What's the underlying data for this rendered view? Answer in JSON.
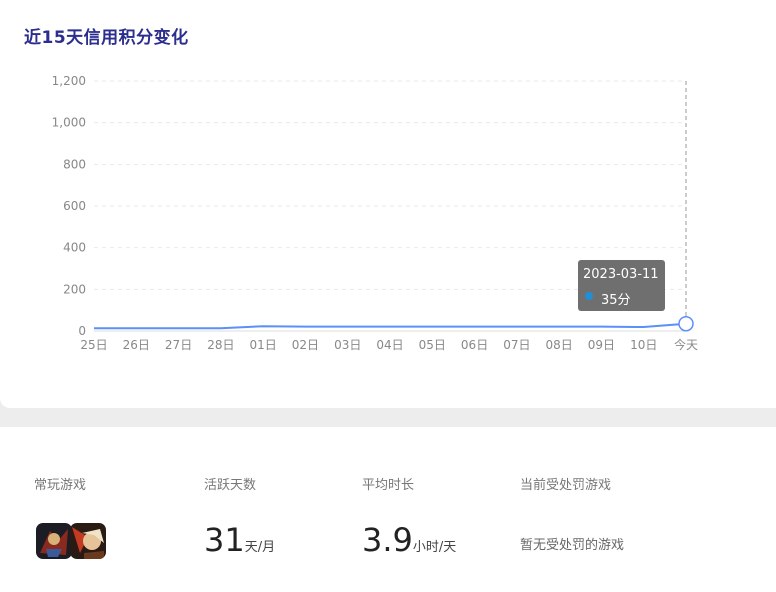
{
  "title": "近15天信用积分变化",
  "chart_data": {
    "type": "line",
    "categories": [
      "25日",
      "26日",
      "27日",
      "28日",
      "01日",
      "02日",
      "03日",
      "04日",
      "05日",
      "06日",
      "07日",
      "08日",
      "09日",
      "10日",
      "今天"
    ],
    "values": [
      13,
      13,
      13,
      13,
      23,
      21,
      21,
      21,
      21,
      21,
      21,
      21,
      21,
      19,
      35
    ],
    "y_ticks": [
      "0",
      "200",
      "400",
      "600",
      "800",
      "1,000",
      "1,200"
    ],
    "ylim": [
      0,
      1200
    ],
    "grid": true,
    "line_color": "#5b8ff9"
  },
  "tooltip": {
    "date": "2023-03-11",
    "value": "35分",
    "dot_color": "#1f8fd6"
  },
  "stats": {
    "games_label": "常玩游戏",
    "active_label": "活跃天数",
    "active_value": "31",
    "active_unit": "天/月",
    "duration_label": "平均时长",
    "duration_value": "3.9",
    "duration_unit": "小时/天",
    "punish_label": "当前受处罚游戏",
    "punish_value": "暂无受处罚的游戏"
  }
}
